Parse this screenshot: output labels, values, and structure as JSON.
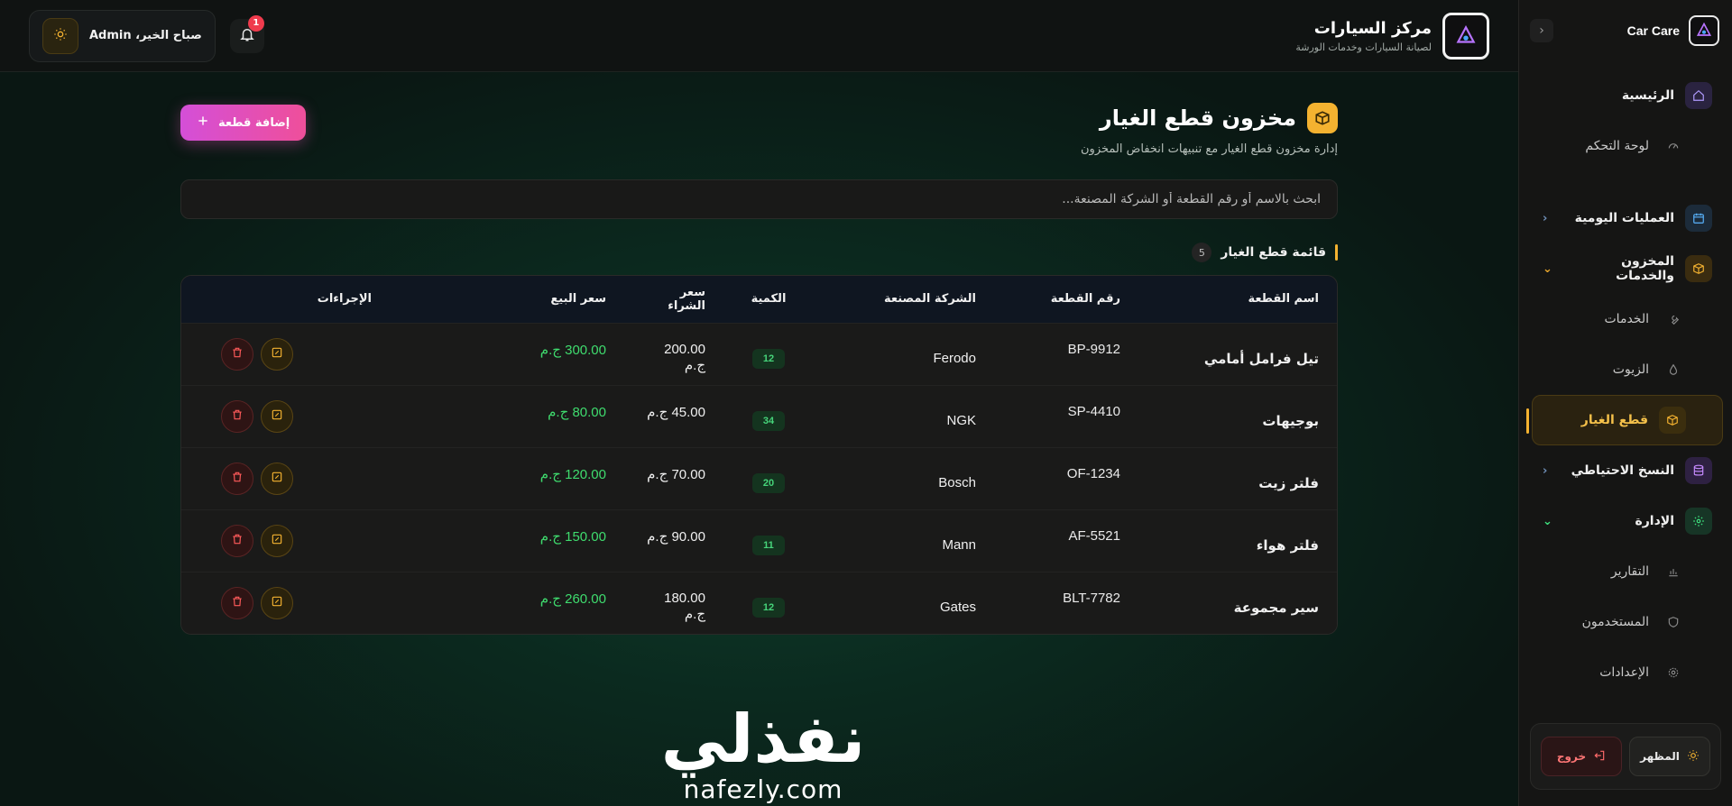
{
  "sidebar": {
    "brand": "Car Care",
    "items": [
      {
        "label": "الرئيسية",
        "icon": "home-icon"
      },
      {
        "label": "لوحة التحكم",
        "icon": "gauge-icon"
      },
      {
        "label": "العمليات اليومية",
        "icon": "calendar-icon"
      },
      {
        "label": "المخزون والخدمات",
        "icon": "box-icon"
      },
      {
        "label": "الخدمات",
        "icon": "wrench-icon"
      },
      {
        "label": "الزيوت",
        "icon": "oil-drop-icon"
      },
      {
        "label": "قطع الغيار",
        "icon": "package-icon",
        "active": true
      },
      {
        "label": "النسخ الاحتياطي",
        "icon": "database-icon"
      },
      {
        "label": "الإدارة",
        "icon": "cog-icon"
      },
      {
        "label": "التقارير",
        "icon": "bar-chart-icon"
      },
      {
        "label": "المستخدمون",
        "icon": "shield-icon"
      },
      {
        "label": "الإعدادات",
        "icon": "settings-icon"
      }
    ],
    "theme_label": "المظهر",
    "logout_label": "خروج"
  },
  "topbar": {
    "title": "مركز السيارات",
    "subtitle": "لصيانة السيارات وخدمات الورشة",
    "greeting": "صباح الخير، Admin",
    "notifications": "1"
  },
  "page": {
    "title": "مخزون قطع الغيار",
    "subtitle": "إدارة مخزون قطع الغيار مع تنبيهات انخفاض المخزون",
    "add_button": "إضافة قطعة",
    "search_placeholder": "ابحث بالاسم أو رقم القطعة أو الشركة المصنعة...",
    "list_title": "قائمة قطع الغيار",
    "list_count": "5"
  },
  "table": {
    "headers": [
      "اسم القطعة",
      "رقم القطعة",
      "الشركة المصنعة",
      "الكمية",
      "سعر الشراء",
      "سعر البيع",
      "الإجراءات"
    ],
    "rows": [
      {
        "name": "تيل فرامل أمامي",
        "part_no": "BP-9912",
        "maker": "Ferodo",
        "qty": "12",
        "buy": "200.00 ج.م",
        "sell": "300.00 ج.م"
      },
      {
        "name": "بوجيهات",
        "part_no": "SP-4410",
        "maker": "NGK",
        "qty": "34",
        "buy": "45.00 ج.م",
        "sell": "80.00 ج.م"
      },
      {
        "name": "فلتر زيت",
        "part_no": "OF-1234",
        "maker": "Bosch",
        "qty": "20",
        "buy": "70.00 ج.م",
        "sell": "120.00 ج.م"
      },
      {
        "name": "فلتر هواء",
        "part_no": "AF-5521",
        "maker": "Mann",
        "qty": "11",
        "buy": "90.00 ج.م",
        "sell": "150.00 ج.م"
      },
      {
        "name": "سير مجموعة",
        "part_no": "BLT-7782",
        "maker": "Gates",
        "qty": "12",
        "buy": "180.00 ج.م",
        "sell": "260.00 ج.م"
      }
    ]
  },
  "watermark": {
    "arabic": "نفذلي",
    "latin": "nafezly.com"
  },
  "colors": {
    "accent": "#f4b230",
    "add_button_from": "#d44fd8",
    "add_button_to": "#ef4f9a",
    "sell_price": "#3fdc6e",
    "qty_badge": "#46d47a"
  }
}
